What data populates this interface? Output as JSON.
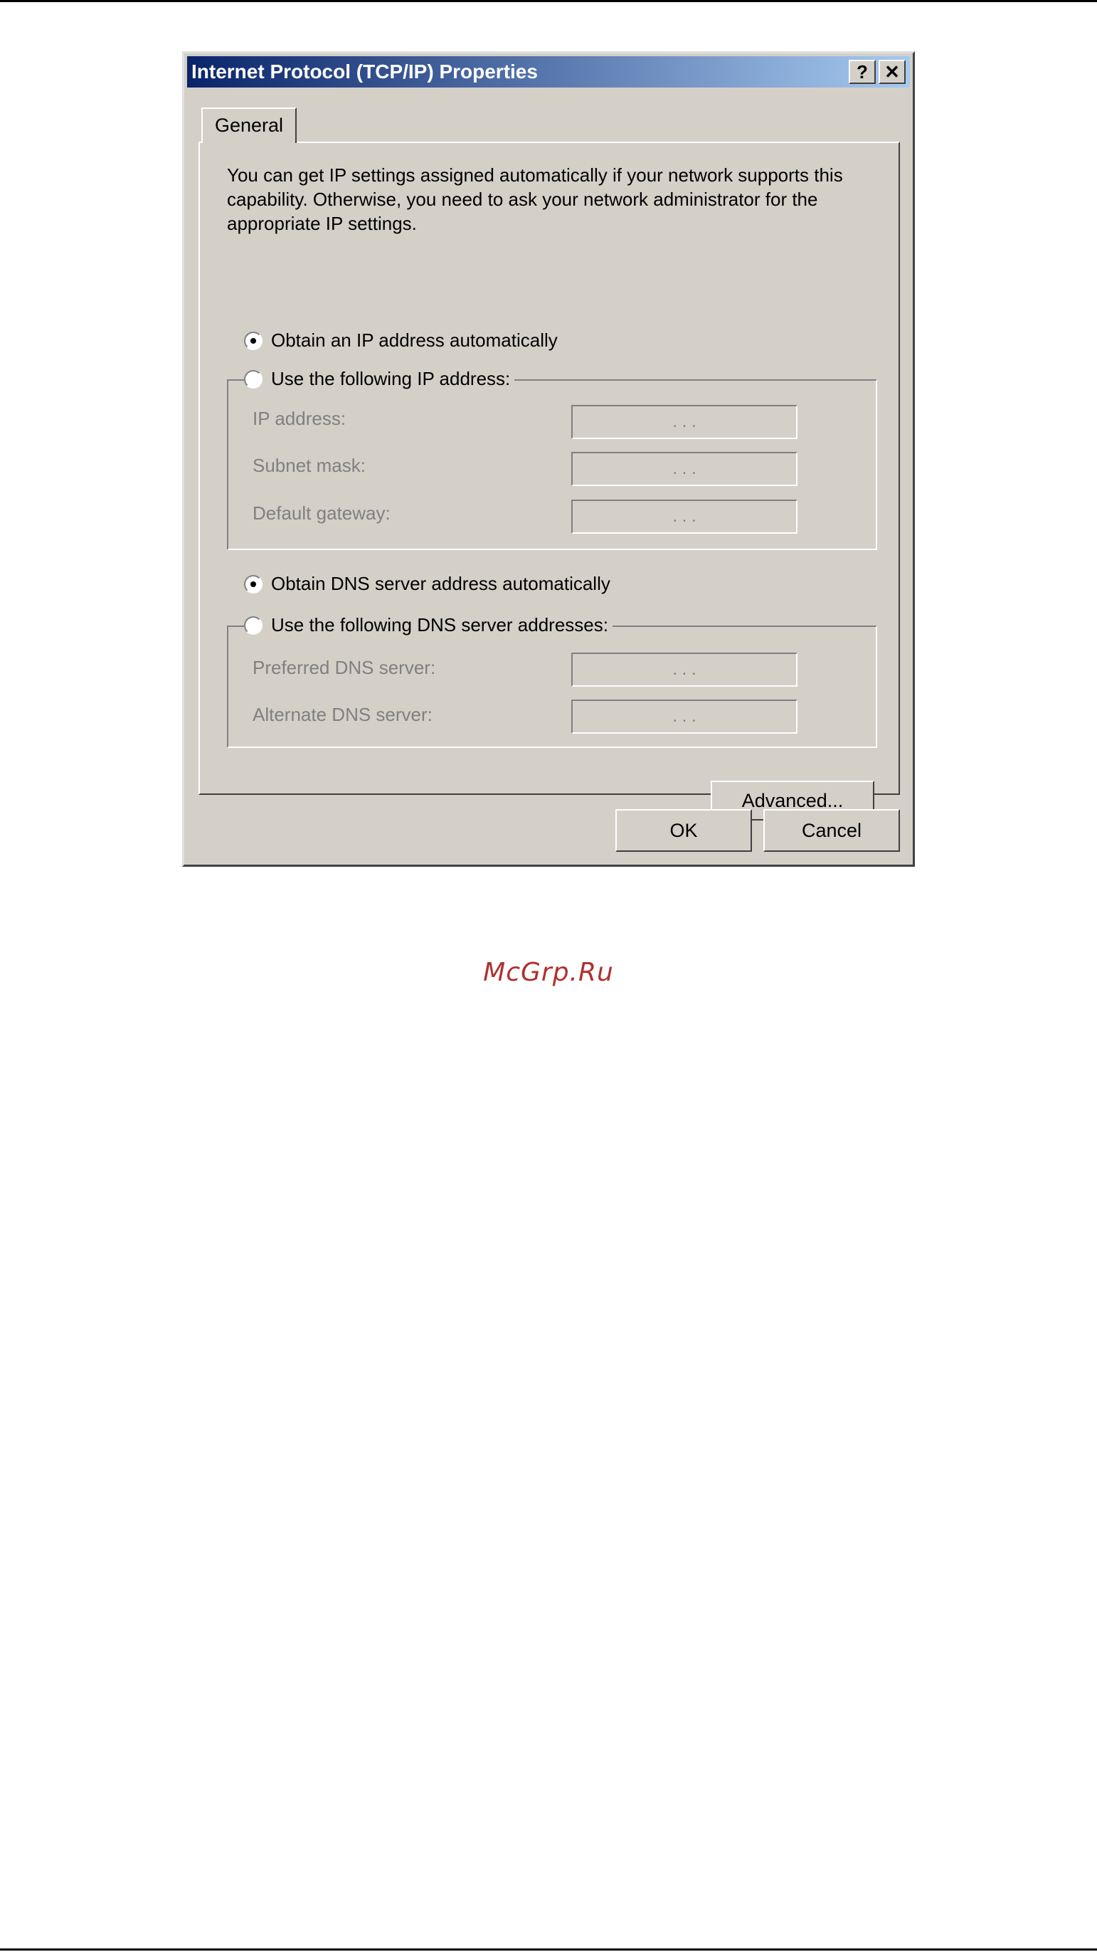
{
  "window": {
    "title": "Internet Protocol (TCP/IP) Properties",
    "help_glyph": "?",
    "close_glyph": "✕"
  },
  "tabs": [
    {
      "label": "General",
      "selected": true
    }
  ],
  "description": "You can get IP settings assigned automatically if your network supports this capability. Otherwise, you need to ask your network administrator for the appropriate IP settings.",
  "ip_section": {
    "auto_label": "Obtain an IP address automatically",
    "auto_selected": true,
    "manual_label": "Use the following IP address:",
    "manual_selected": false,
    "fields": [
      {
        "label": "IP address:",
        "value": ". . ."
      },
      {
        "label": "Subnet mask:",
        "value": ". . ."
      },
      {
        "label": "Default gateway:",
        "value": ". . ."
      }
    ]
  },
  "dns_section": {
    "auto_label": "Obtain DNS server address automatically",
    "auto_selected": true,
    "manual_label": "Use the following DNS server addresses:",
    "manual_selected": false,
    "fields": [
      {
        "label": "Preferred DNS server:",
        "value": ". . ."
      },
      {
        "label": "Alternate DNS server:",
        "value": ". . ."
      }
    ]
  },
  "buttons": {
    "advanced": "Advanced...",
    "ok": "OK",
    "cancel": "Cancel"
  },
  "watermark": "McGrp.Ru"
}
